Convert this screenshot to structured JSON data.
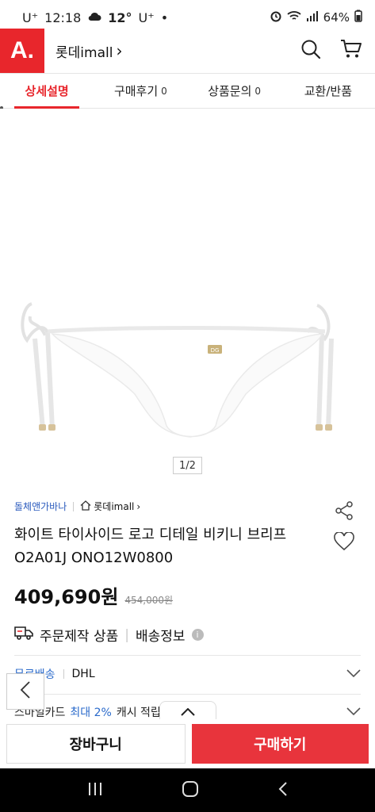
{
  "status": {
    "carrier": "U⁺",
    "time": "12:18",
    "weather_temp": "12°",
    "carrier2": "U⁺",
    "dot": "•",
    "battery": "64%"
  },
  "header": {
    "logo": "A.",
    "mall_link": "롯데imall",
    "mall_chevron": "›"
  },
  "tabs": [
    {
      "label": "상세설명",
      "count": ""
    },
    {
      "label": "구매후기",
      "count": "0"
    },
    {
      "label": "상품문의",
      "count": "0"
    },
    {
      "label": "교환/반품",
      "count": ""
    }
  ],
  "pager": "1/2",
  "product": {
    "brand": "돌체앤가바나",
    "store": "롯데imall",
    "store_chevron": "›",
    "title": "화이트 타이사이드 로고 디테일 비키니 브리프 O2A01J ONO12W0800",
    "price": "409,690원",
    "original_price": "454,000원"
  },
  "shipping": {
    "order_made": "주문제작 상품",
    "divider": "|",
    "info": "배송정보",
    "info_icon": "i",
    "free_shipping": "무료배송",
    "carrier": "DHL",
    "card_prefix": "스마일카드",
    "card_highlight": "최대 2%",
    "card_suffix": "캐시 적립"
  },
  "actions": {
    "cart": "장바구니",
    "buy": "구매하기"
  },
  "colors": {
    "brand_red": "#e8262c",
    "buy_red": "#e8343c",
    "link_blue": "#2b5bbd"
  },
  "icons": [
    "search-icon",
    "cart-icon",
    "share-icon",
    "heart-icon",
    "truck-icon",
    "chevron-down-icon",
    "chevron-left-icon",
    "chevron-up-icon"
  ]
}
